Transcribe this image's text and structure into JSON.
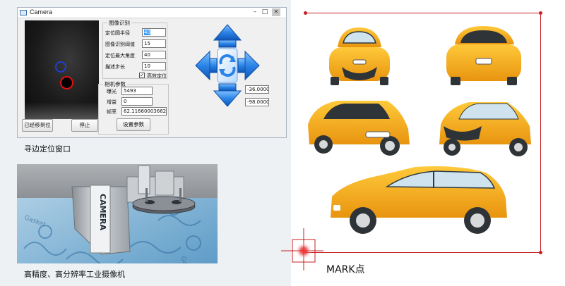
{
  "window": {
    "title": "Camera",
    "controls": {
      "minimize": "–",
      "maximize": "□",
      "close": "×"
    }
  },
  "buttons": {
    "moved": "已经移到位",
    "stop": "停止",
    "set_params": "设置参数"
  },
  "image_recognition": {
    "group_title": "图像识别",
    "fields": [
      {
        "label": "定位圆半径",
        "value": "40"
      },
      {
        "label": "图像识别阈值",
        "value": "15"
      },
      {
        "label": "定位最大角度",
        "value": "40"
      },
      {
        "label": "描述步长",
        "value": "10"
      }
    ],
    "checkbox_label": "高效定位",
    "checkbox_checked": true
  },
  "camera_params": {
    "group_title": "相机参数",
    "fields": [
      {
        "label": "曝光",
        "value": "5493"
      },
      {
        "label": "增益",
        "value": "0"
      },
      {
        "label": "帧率",
        "value": "62.11660003662"
      }
    ]
  },
  "coordinates": {
    "x": "-36.000000",
    "y": "-98.000000"
  },
  "arrow_pad": {
    "up": "up-arrow-icon",
    "down": "down-arrow-icon",
    "left": "left-arrow-icon",
    "right": "right-arrow-icon",
    "center": "refresh-icon"
  },
  "captions": {
    "window": "寻边定位窗口",
    "camera": "高精度、高分辨率工业摄像机",
    "mark": "MARK点"
  },
  "photo": {
    "camera_label": "CAMERA"
  },
  "colors": {
    "arrow_blue": "#1a6fd1",
    "car_yellow": "#f2a81d",
    "mark_red": "#c62020"
  }
}
